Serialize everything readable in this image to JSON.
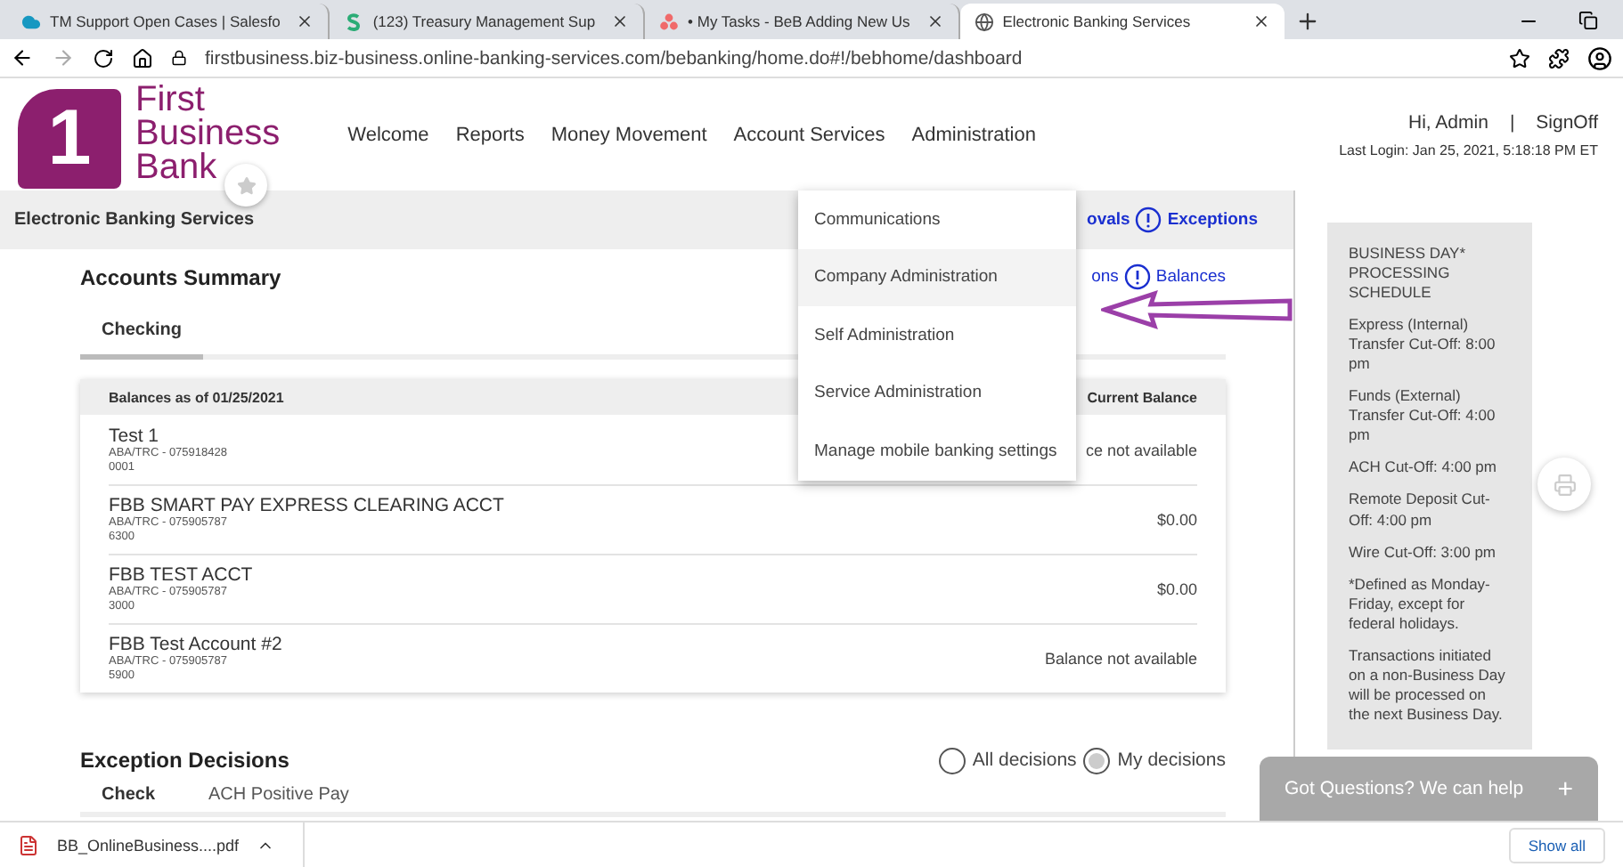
{
  "browser": {
    "tabs": [
      {
        "title": "TM Support Open Cases | Salesfo",
        "selected": false
      },
      {
        "title": "(123) Treasury Management Sup",
        "selected": false
      },
      {
        "title": "• My Tasks - BeB Adding New Us",
        "selected": false
      },
      {
        "title": "Electronic Banking Services",
        "selected": true
      }
    ],
    "url": "firstbusiness.biz-business.online-banking-services.com/bebanking/home.do#!/bebhome/dashboard"
  },
  "header": {
    "logo": [
      "First",
      "Business",
      "Bank"
    ],
    "logo_mark": "1",
    "nav": [
      "Welcome",
      "Reports",
      "Money Movement",
      "Account Services",
      "Administration"
    ],
    "greeting": "Hi, Admin",
    "separator": "|",
    "signoff": "SignOff",
    "last_login": "Last Login: Jan 25, 2021, 5:18:18 PM ET"
  },
  "menu": [
    {
      "label": "Communications",
      "selected": false
    },
    {
      "label": "Company Administration",
      "selected": true
    },
    {
      "label": "Self Administration",
      "selected": false
    },
    {
      "label": "Service Administration",
      "selected": false
    },
    {
      "label": "Manage mobile banking settings",
      "selected": false
    }
  ],
  "subheader": {
    "title": "Electronic Banking Services",
    "links": [
      "ovals",
      "Exceptions"
    ]
  },
  "accounts": {
    "title": "Accounts Summary",
    "links": [
      "ons",
      "Balances"
    ],
    "tabs": [
      {
        "label": "Checking",
        "selected": true
      }
    ],
    "table": {
      "date_label": "Balances as of 01/25/2021",
      "balance_label": "Current Balance",
      "rows": [
        {
          "name": "Test 1",
          "routing": "ABA/TRC - 075918428",
          "number": "0001",
          "balance": "ce not available"
        },
        {
          "name": "FBB SMART PAY EXPRESS CLEARING ACCT",
          "routing": "ABA/TRC - 075905787",
          "number": "6300",
          "balance": "$0.00"
        },
        {
          "name": "FBB TEST ACCT",
          "routing": "ABA/TRC - 075905787",
          "number": "3000",
          "balance": "$0.00"
        },
        {
          "name": "FBB Test Account #2",
          "routing": "ABA/TRC - 075905787",
          "number": "5900",
          "balance": "Balance not available"
        }
      ]
    }
  },
  "schedule": [
    "BUSINESS DAY* PROCESSING SCHEDULE",
    "Express (Internal) Transfer Cut-Off: 8:00 pm",
    "Funds (External) Transfer Cut-Off: 4:00 pm",
    "ACH Cut-Off: 4:00 pm",
    "Remote Deposit Cut-Off: 4:00 pm",
    "Wire Cut-Off: 3:00 pm",
    "*Defined as Monday-Friday, except for federal holidays.",
    "Transactions initiated on a non-Business Day will be processed on the next Business Day."
  ],
  "exceptions": {
    "title": "Exception Decisions",
    "radios": [
      {
        "label": "All decisions",
        "selected": false
      },
      {
        "label": "My decisions",
        "selected": true
      }
    ],
    "tabs": [
      {
        "label": "Check",
        "selected": true
      },
      {
        "label": "ACH Positive Pay",
        "selected": false
      }
    ]
  },
  "chat": {
    "label": "Got Questions? We can help",
    "button": "+"
  },
  "downloads": {
    "file": "BB_OnlineBusiness....pdf",
    "show_all": "Show all"
  }
}
